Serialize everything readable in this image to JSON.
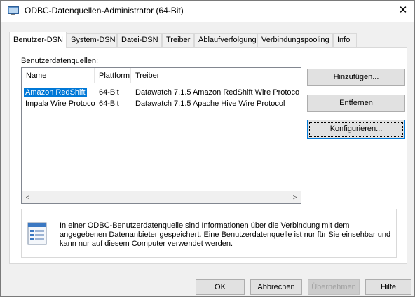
{
  "window": {
    "title": "ODBC-Datenquellen-Administrator (64-Bit)",
    "close_glyph": "✕"
  },
  "tabs": [
    {
      "label": "Benutzer-DSN",
      "active": true
    },
    {
      "label": "System-DSN"
    },
    {
      "label": "Datei-DSN"
    },
    {
      "label": "Treiber"
    },
    {
      "label": "Ablaufverfolgung"
    },
    {
      "label": "Verbindungspooling"
    },
    {
      "label": "Info"
    }
  ],
  "panel": {
    "section_label": "Benutzerdatenquellen:",
    "columns": [
      "Name",
      "Plattform",
      "Treiber"
    ],
    "rows": [
      {
        "name": "Amazon RedShift",
        "platform": "64-Bit",
        "driver": "Datawatch 7.1.5 Amazon RedShift Wire Protoco",
        "selected": true
      },
      {
        "name": "Impala Wire Protocol",
        "platform": "64-Bit",
        "driver": "Datawatch 7.1.5 Apache Hive Wire Protocol",
        "selected": false
      }
    ],
    "scroll_left": "<",
    "scroll_right": ">",
    "buttons": {
      "add": "Hinzufügen...",
      "remove": "Entfernen",
      "configure": "Konfigurieren..."
    },
    "info_text": "In einer ODBC-Benutzerdatenquelle sind Informationen über die Verbindung mit dem angegebenen Datenanbieter gespeichert. Eine Benutzerdatenquelle ist nur für Sie einsehbar und kann nur auf diesem Computer verwendet werden."
  },
  "footer": {
    "ok": "OK",
    "cancel": "Abbrechen",
    "apply": "Übernehmen",
    "help": "Hilfe"
  }
}
